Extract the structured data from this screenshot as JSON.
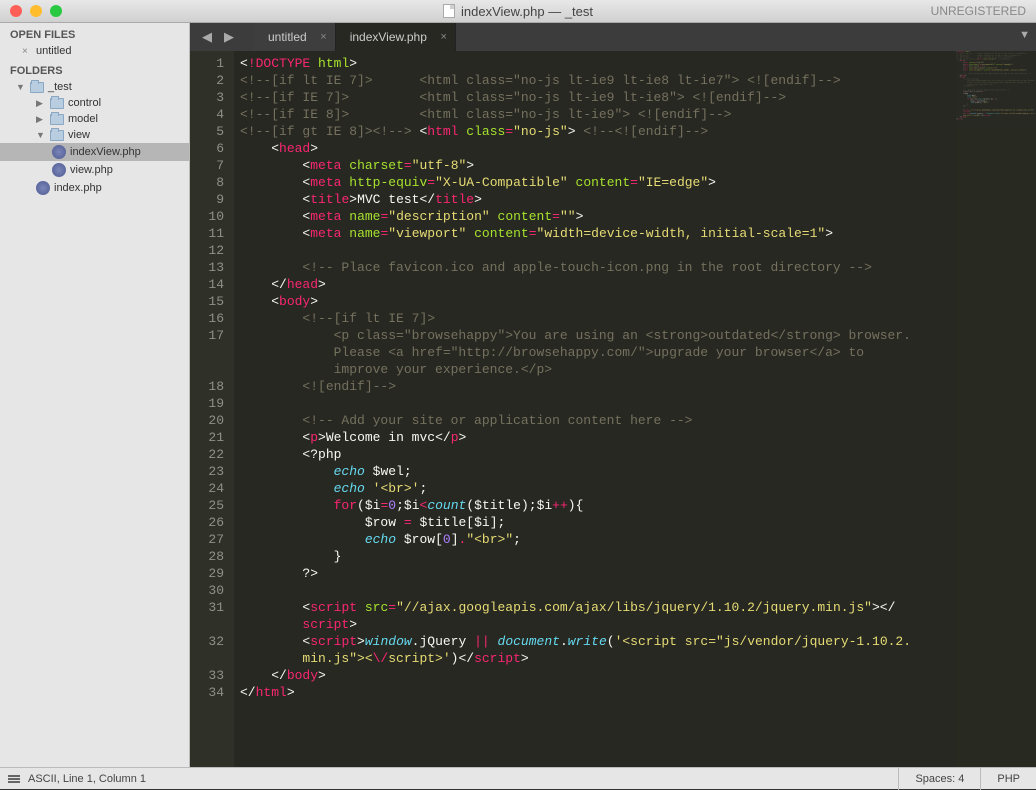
{
  "titlebar": {
    "filename": "indexView.php",
    "separator": " — ",
    "project": "_test",
    "unregistered": "UNREGISTERED"
  },
  "sidebar": {
    "open_files_label": "OPEN FILES",
    "open_files": [
      {
        "name": "untitled",
        "dirty": false
      }
    ],
    "folders_label": "FOLDERS",
    "project_root": "_test",
    "tree": {
      "control": "control",
      "model": "model",
      "view": "view",
      "indexViewPhp": "indexView.php",
      "viewPhp": "view.php",
      "indexPhp": "index.php"
    }
  },
  "tabs": [
    {
      "label": "untitled",
      "active": false
    },
    {
      "label": "indexView.php",
      "active": true
    }
  ],
  "code": {
    "lines": [
      {
        "n": 1,
        "html": "<span class='c-angle'>&lt;</span><span class='c-doctype'>!DOCTYPE</span> <span class='c-attr'>html</span><span class='c-angle'>&gt;</span>"
      },
      {
        "n": 2,
        "html": "<span class='c-comment'>&lt;!--[if lt IE 7]&gt;      &lt;html class=\"no-js lt-ie9 lt-ie8 lt-ie7\"&gt; &lt;![endif]--&gt;</span>"
      },
      {
        "n": 3,
        "html": "<span class='c-comment'>&lt;!--[if IE 7]&gt;         &lt;html class=\"no-js lt-ie9 lt-ie8\"&gt; &lt;![endif]--&gt;</span>"
      },
      {
        "n": 4,
        "html": "<span class='c-comment'>&lt;!--[if IE 8]&gt;         &lt;html class=\"no-js lt-ie9\"&gt; &lt;![endif]--&gt;</span>"
      },
      {
        "n": 5,
        "html": "<span class='c-comment'>&lt;!--[if gt IE 8]&gt;&lt;!--&gt;</span> <span class='c-angle'>&lt;</span><span class='c-tag'>html</span> <span class='c-attr'>class</span><span class='c-op'>=</span><span class='c-val'>\"no-js\"</span><span class='c-angle'>&gt;</span> <span class='c-comment'>&lt;!--&lt;![endif]--&gt;</span>"
      },
      {
        "n": 6,
        "html": "    <span class='c-angle'>&lt;</span><span class='c-tag'>head</span><span class='c-angle'>&gt;</span>"
      },
      {
        "n": 7,
        "html": "        <span class='c-angle'>&lt;</span><span class='c-tag'>meta</span> <span class='c-attr'>charset</span><span class='c-op'>=</span><span class='c-val'>\"utf-8\"</span><span class='c-angle'>&gt;</span>"
      },
      {
        "n": 8,
        "html": "        <span class='c-angle'>&lt;</span><span class='c-tag'>meta</span> <span class='c-attr'>http-equiv</span><span class='c-op'>=</span><span class='c-val'>\"X-UA-Compatible\"</span> <span class='c-attr'>content</span><span class='c-op'>=</span><span class='c-val'>\"IE=edge\"</span><span class='c-angle'>&gt;</span>"
      },
      {
        "n": 9,
        "html": "        <span class='c-angle'>&lt;</span><span class='c-tag'>title</span><span class='c-angle'>&gt;</span>MVC test<span class='c-angle'>&lt;/</span><span class='c-tag'>title</span><span class='c-angle'>&gt;</span>"
      },
      {
        "n": 10,
        "html": "        <span class='c-angle'>&lt;</span><span class='c-tag'>meta</span> <span class='c-attr'>name</span><span class='c-op'>=</span><span class='c-val'>\"description\"</span> <span class='c-attr'>content</span><span class='c-op'>=</span><span class='c-val'>\"\"</span><span class='c-angle'>&gt;</span>"
      },
      {
        "n": 11,
        "html": "        <span class='c-angle'>&lt;</span><span class='c-tag'>meta</span> <span class='c-attr'>name</span><span class='c-op'>=</span><span class='c-val'>\"viewport\"</span> <span class='c-attr'>content</span><span class='c-op'>=</span><span class='c-val'>\"width=device-width, initial-scale=1\"</span><span class='c-angle'>&gt;</span>"
      },
      {
        "n": 12,
        "html": ""
      },
      {
        "n": 13,
        "html": "        <span class='c-comment'>&lt;!-- Place favicon.ico and apple-touch-icon.png in the root directory --&gt;</span>"
      },
      {
        "n": 14,
        "html": "    <span class='c-angle'>&lt;/</span><span class='c-tag'>head</span><span class='c-angle'>&gt;</span>"
      },
      {
        "n": 15,
        "html": "    <span class='c-angle'>&lt;</span><span class='c-tag'>body</span><span class='c-angle'>&gt;</span>"
      },
      {
        "n": 16,
        "html": "        <span class='c-comment'>&lt;!--[if lt IE 7]&gt;</span>"
      },
      {
        "n": 17,
        "html": "<span class='c-comment'>            &lt;p class=\"browsehappy\"&gt;You are using an &lt;strong&gt;outdated&lt;/strong&gt; browser. \n            Please &lt;a href=\"http://browsehappy.com/\"&gt;upgrade your browser&lt;/a&gt; to \n            improve your experience.&lt;/p&gt;</span>"
      },
      {
        "n": 18,
        "html": "        <span class='c-comment'>&lt;![endif]--&gt;</span>"
      },
      {
        "n": 19,
        "html": ""
      },
      {
        "n": 20,
        "html": "        <span class='c-comment'>&lt;!-- Add your site or application content here --&gt;</span>"
      },
      {
        "n": 21,
        "html": "        <span class='c-angle'>&lt;</span><span class='c-tag'>p</span><span class='c-angle'>&gt;</span>Welcome in mvc<span class='c-angle'>&lt;/</span><span class='c-tag'>p</span><span class='c-angle'>&gt;</span>"
      },
      {
        "n": 22,
        "html": "        <span class='c-php'>&lt;?php</span>"
      },
      {
        "n": 23,
        "html": "            <span class='c-func'>echo</span> <span class='c-var'>$wel</span>;"
      },
      {
        "n": 24,
        "html": "            <span class='c-func'>echo</span> <span class='c-val'>'&lt;br&gt;'</span>;"
      },
      {
        "n": 25,
        "html": "            <span class='c-keyword'>for</span>(<span class='c-var'>$i</span><span class='c-op'>=</span><span class='c-num'>0</span>;<span class='c-var'>$i</span><span class='c-op'>&lt;</span><span class='c-func'>count</span>(<span class='c-var'>$title</span>);<span class='c-var'>$i</span><span class='c-op'>++</span>){"
      },
      {
        "n": 26,
        "html": "                <span class='c-var'>$row</span> <span class='c-op'>=</span> <span class='c-var'>$title</span>[<span class='c-var'>$i</span>];"
      },
      {
        "n": 27,
        "html": "                <span class='c-func'>echo</span> <span class='c-var'>$row</span>[<span class='c-num'>0</span>]<span class='c-op'>.</span><span class='c-val'>\"&lt;br&gt;\"</span>;"
      },
      {
        "n": 28,
        "html": "            }"
      },
      {
        "n": 29,
        "html": "        <span class='c-php'>?&gt;</span>"
      },
      {
        "n": 30,
        "html": ""
      },
      {
        "n": 31,
        "html": "        <span class='c-angle'>&lt;</span><span class='c-tag'>script</span> <span class='c-attr'>src</span><span class='c-op'>=</span><span class='c-val'>\"//ajax.googleapis.com/ajax/libs/jquery/1.10.2/jquery.min.js\"</span><span class='c-angle'>&gt;&lt;/</span>\n        <span class='c-tag'>script</span><span class='c-angle'>&gt;</span>"
      },
      {
        "n": 32,
        "html": "        <span class='c-angle'>&lt;</span><span class='c-tag'>script</span><span class='c-angle'>&gt;</span><span class='c-entity'>window</span><span class='c-text'>.jQuery</span> <span class='c-op'>||</span> <span class='c-entity'>document</span><span class='c-text'>.</span><span class='c-func'>write</span>(<span class='c-val'>'&lt;script src=\"js/vendor/jquery-1.10.2.\n        min.js\"&gt;&lt;</span><span class='c-op'>\\/</span><span class='c-val'>script&gt;'</span>)<span class='c-angle'>&lt;/</span><span class='c-tag'>script</span><span class='c-angle'>&gt;</span>"
      },
      {
        "n": 33,
        "html": "    <span class='c-angle'>&lt;/</span><span class='c-tag'>body</span><span class='c-angle'>&gt;</span>"
      },
      {
        "n": 34,
        "html": "<span class='c-angle'>&lt;/</span><span class='c-tag'>html</span><span class='c-angle'>&gt;</span>"
      }
    ]
  },
  "status": {
    "encoding": "ASCII, Line 1, Column 1",
    "spaces": "Spaces: 4",
    "lang": "PHP"
  }
}
